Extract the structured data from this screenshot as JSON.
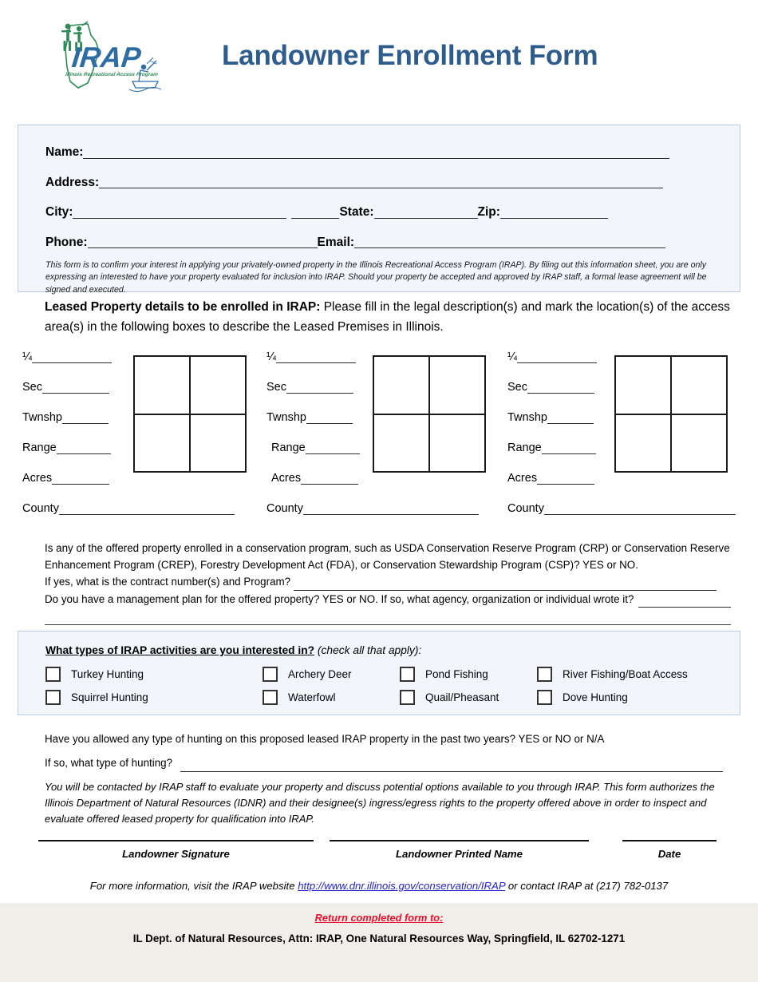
{
  "header": {
    "title": "Landowner Enrollment Form",
    "logo": {
      "name": "irap-logo",
      "acronym": "IRAP",
      "tagline": "Illinois Recreational Access Program"
    },
    "title_color": "#2E5C8C"
  },
  "contact": {
    "name_label": "Name:",
    "address_label": "Address:",
    "city_label": "City:",
    "state_label": "State:",
    "zip_label": "Zip:",
    "phone_label": "Phone:",
    "email_label": "Email:",
    "name_value": "",
    "address_value": "",
    "city_value": "",
    "state_value": "",
    "zip_value": "",
    "phone_value": "",
    "email_value": "",
    "disclaimer": "This form is to confirm your interest in applying your privately-owned property in the Illinois Recreational Access Program (IRAP).  By filing out this information sheet, you are only expressing an interested to have your property evaluated for inclusion into IRAP.  Should your property be accepted and approved by IRAP staff, a formal lease agreement will be signed and executed.",
    "panel_bg": "#F2F6FB",
    "panel_border": "#B8CCE4"
  },
  "lease_section": {
    "heading_bold": "Leased Property details to be enrolled in IRAP:",
    "heading_rest": "  Please fill in the legal description(s) and mark the location(s) of the access area(s) in the following boxes to describe the Leased Premises in Illinois.",
    "labels": {
      "quarter": "¼",
      "sec": "Sec",
      "twnshp": "Twnshp",
      "range": "Range",
      "acres": "Acres",
      "county": "County"
    },
    "parcels": [
      {
        "quarter": "",
        "sec": "",
        "twnshp": "",
        "range": "",
        "acres": "",
        "county": ""
      },
      {
        "quarter": "",
        "sec": "",
        "twnshp": "",
        "range": "",
        "acres": "",
        "county": ""
      },
      {
        "quarter": "",
        "sec": "",
        "twnshp": "",
        "range": "",
        "acres": "",
        "county": ""
      }
    ]
  },
  "conservation": {
    "q1": "Is any of the offered property enrolled in a conservation program, such as USDA Conservation Reserve Program (CRP) or Conservation Reserve Enhancement Program (CREP), Forestry Development Act (FDA), or Conservation Stewardship Program (CSP)?  YES or  NO.",
    "q2": "If yes, what is the contract number(s) and Program?",
    "q3": "Do you have a management plan for the offered property?  YES or NO. If so, what agency, organization or individual wrote it?"
  },
  "activities": {
    "heading_underlined": "What types of IRAP activities are you interested in?",
    "heading_italic": " (check all that apply):",
    "items": [
      {
        "label": "Turkey Hunting",
        "checked": false
      },
      {
        "label": "Archery Deer",
        "checked": false
      },
      {
        "label": "Pond Fishing",
        "checked": false
      },
      {
        "label": "River Fishing/Boat Access",
        "checked": false
      },
      {
        "label": "Squirrel Hunting",
        "checked": false
      },
      {
        "label": "Waterfowl",
        "checked": false
      },
      {
        "label": "Quail/Pheasant",
        "checked": false
      },
      {
        "label": "Dove Hunting",
        "checked": false
      }
    ]
  },
  "hunting": {
    "q1": "Have you allowed any type of hunting on this proposed leased IRAP property in the past two years?    YES or NO or N/A",
    "q2": "If so, what type of hunting?",
    "authorization": "You will be contacted by IRAP staff to evaluate your property and discuss potential options available to you through IRAP.  This form authorizes the Illinois Department of Natural Resources (IDNR) and their designee(s) ingress/egress rights to the property offered above in order to inspect and evaluate offered leased property for qualification into IRAP."
  },
  "signatures": [
    {
      "label": "Landowner Signature",
      "value": ""
    },
    {
      "label": "Landowner Printed Name",
      "value": ""
    },
    {
      "label": "Date",
      "value": ""
    }
  ],
  "more_info": {
    "prefix": "For more information, visit the IRAP website ",
    "url": "http://www.dnr.illinois.gov/conservation/IRAP",
    "suffix": " or contact IRAP at (217) 782-0137",
    "link_color": "#2222CC"
  },
  "footer": {
    "return_label": "Return completed form to:",
    "address": "IL Dept. of Natural Resources, Attn: IRAP, One Natural Resources Way, Springfield, IL 62702-1271",
    "bg": "#F0EEE8",
    "return_color": "#E8112D"
  }
}
